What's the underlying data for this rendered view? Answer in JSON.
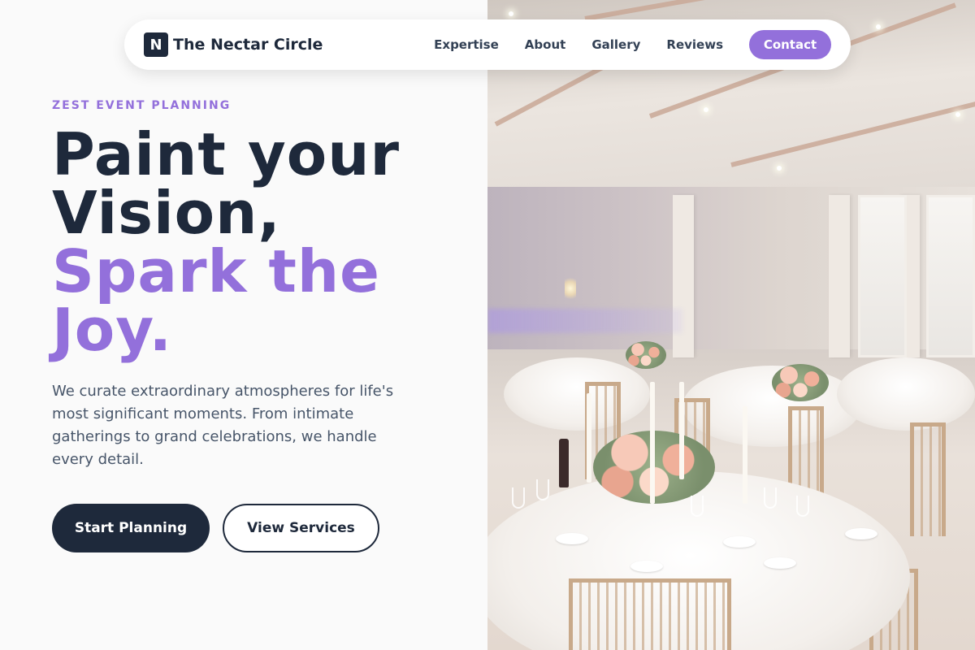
{
  "brand": {
    "logo_letter": "N",
    "name": "The Nectar Circle"
  },
  "nav": {
    "links": [
      "Expertise",
      "About",
      "Gallery",
      "Reviews"
    ],
    "contact_label": "Contact"
  },
  "hero": {
    "eyebrow": "ZEST EVENT PLANNING",
    "headline_line1": "Paint your Vision,",
    "headline_accent": "Spark the Joy.",
    "lede": "We curate extraordinary atmospheres for life's most significant moments. From intimate gatherings to grand celebrations, we handle every detail.",
    "primary_cta": "Start Planning",
    "secondary_cta": "View Services"
  },
  "colors": {
    "accent": "#9370db",
    "dark": "#1e293b",
    "body_text": "#475569",
    "background": "#fafafa"
  },
  "hero_image": {
    "subject": "banquet-hall-photo"
  }
}
